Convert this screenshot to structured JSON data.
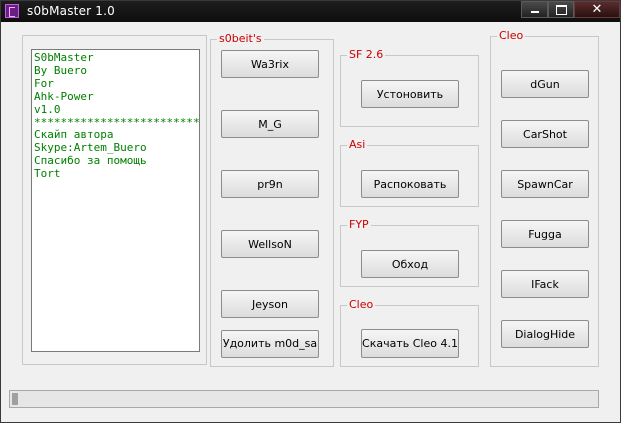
{
  "window": {
    "title": "s0bMaster 1.0"
  },
  "titlebar_buttons": {
    "minimize": "▬",
    "maximize": "□",
    "close": "✕"
  },
  "info_text": [
    "S0bMaster",
    "By Buero",
    "For",
    "Ahk-Power",
    "v1.0",
    "****************************",
    "Скайп автора",
    "Skype:Artem_Buero",
    "Спасибо за помощь",
    "Tort"
  ],
  "s0beits": {
    "label": "s0beit's",
    "buttons": [
      "Wa3rix",
      "M_G",
      "pr9n",
      "WellsoN",
      "Jeyson",
      "Удолить m0d_sa"
    ]
  },
  "sf": {
    "label": "SF 2.6",
    "button": "Устоновить"
  },
  "asi": {
    "label": "Asi",
    "button": "Распоковать"
  },
  "fyp": {
    "label": "FYP",
    "button": "Обход"
  },
  "cleo_mid": {
    "label": "Cleo",
    "button": "Скачать Cleo 4.1"
  },
  "cleo_right": {
    "label": "Cleo",
    "buttons": [
      "dGun",
      "CarShot",
      "SpawnCar",
      "Fugga",
      "IFack",
      "DialogHide"
    ]
  },
  "progress": {
    "percent": 1
  },
  "colors": {
    "group_label": "#cc0000",
    "info_text": "#008000",
    "titlebar": "#141414"
  }
}
